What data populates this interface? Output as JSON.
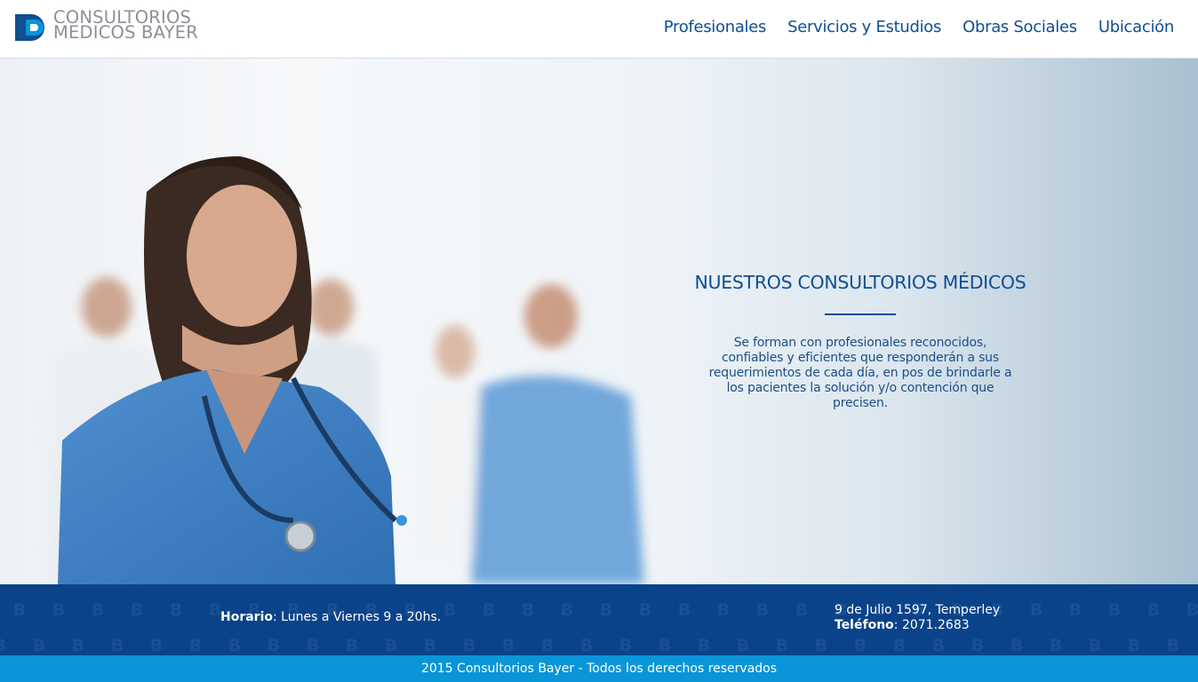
{
  "brand": {
    "line1": "CONSULTORIOS",
    "line2": "MEDICOS BAYER",
    "color_dark": "#0f4f92",
    "color_light": "#0a95d9",
    "icon": "b-logo-icon"
  },
  "nav": {
    "items": [
      "Profesionales",
      "Servicios y Estudios",
      "Obras Sociales",
      "Ubicación"
    ]
  },
  "hero": {
    "title": "NUESTROS CONSULTORIOS MÉDICOS",
    "text": "Se forman con profesionales reconocidos, confiables y eficientes que responderán a sus requerimientos de cada día, en pos de brindarle a los pacientes la solución y/o contención que precisen.",
    "image": "medical-staff-photo"
  },
  "info": {
    "hours_label": "Horario",
    "hours_value": ": Lunes a Viernes 9 a 20hs.",
    "address": "9 de Julio 1597, Temperley",
    "phone_label": "Teléfono",
    "phone_value": ": 2071.2683",
    "background": "#0a4389"
  },
  "footer": {
    "copyright": "2015 Consultorios Bayer - Todos los derechos reservados",
    "background": "#0a95d9"
  }
}
